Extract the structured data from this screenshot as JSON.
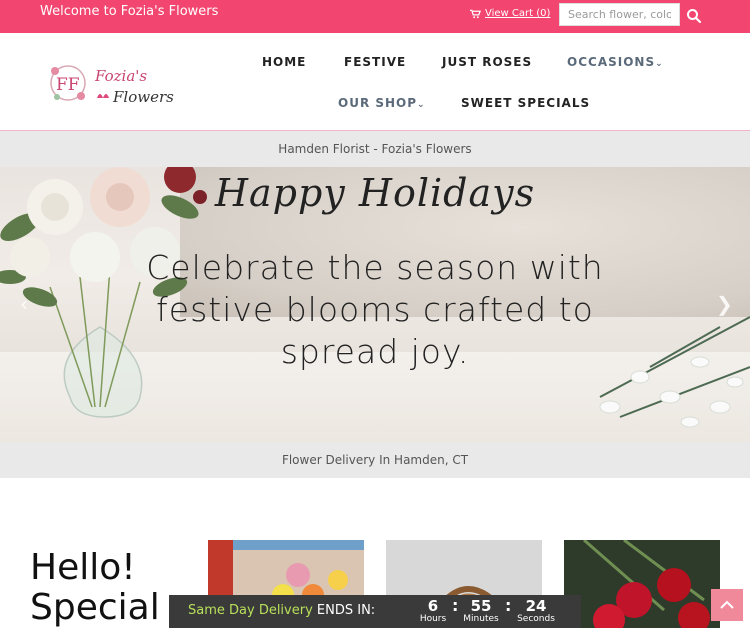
{
  "topbar": {
    "welcome": "Welcome to Fozia's Flowers",
    "cart_label": "View Cart (0)",
    "search_placeholder": "Search flower, color",
    "cart_icon": "cart-icon",
    "search_icon": "search-icon"
  },
  "logo": {
    "text_line1": "Fozia's",
    "text_line2": "Flowers",
    "monogram": "FF"
  },
  "nav": {
    "home": "HOME",
    "festive": "FESTIVE",
    "just_roses": "JUST ROSES",
    "occasions": "OCCASIONS",
    "our_shop": "OUR SHOP",
    "sweet_specials": "SWEET SPECIALS"
  },
  "band_top": "Hamden Florist - Fozia's Flowers",
  "hero": {
    "title": "Happy Holidays",
    "subtitle": "Celebrate the season with festive blooms crafted to spread joy.",
    "prev_arrow": "‹",
    "next_arrow": "❯"
  },
  "band_bottom": "Flower Delivery In Hamden, CT",
  "hello": {
    "line1": "Hello!",
    "line2": "Special"
  },
  "countdown": {
    "label_green": "Same Day Delivery",
    "label_rest": " ENDS IN:",
    "hours": "6",
    "minutes": "55",
    "seconds": "24",
    "hours_label": "Hours",
    "minutes_label": "Minutes",
    "seconds_label": "Seconds",
    "sep": ":"
  },
  "colors": {
    "brand_pink": "#f2456f",
    "countdown_bg": "#3a3a3a",
    "accent_green": "#b8e05a"
  }
}
